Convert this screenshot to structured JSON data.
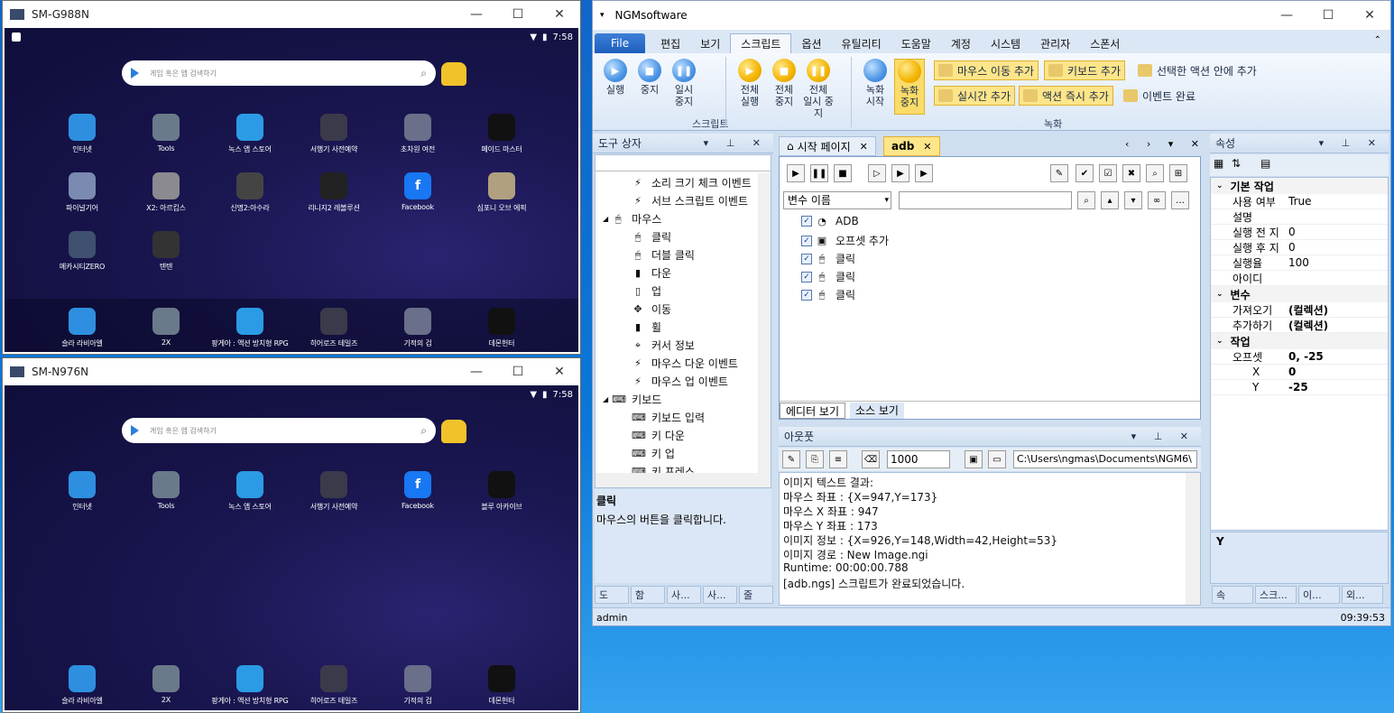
{
  "emulator_top": {
    "title": "SM-G988N",
    "time": "7:58",
    "search_placeholder": "게임 혹은 앱 검색하기",
    "apps_row1": [
      "인터넷",
      "Tools",
      "녹스 앱 스토어",
      "서행기 사전예약",
      "초차원 여전",
      "페이드 마스터"
    ],
    "apps_row2": [
      "파이널기어",
      "X2: 아르킵스",
      "신명2:아수라",
      "리니지2 레볼루션",
      "Facebook",
      "심포니 오브 에픽"
    ],
    "apps_row3": [
      "메카시티ZERO",
      "텐텐"
    ],
    "dock": [
      "슬라 라비아엘",
      "2X",
      "팡게아 : 액션 방치형 RPG",
      "히어로즈 테일즈",
      "기적의 검",
      "데몬헌터"
    ]
  },
  "emulator_bottom": {
    "title": "SM-N976N",
    "time": "7:58",
    "search_placeholder": "게임 혹은 앱 검색하기",
    "apps_row1": [
      "인터넷",
      "Tools",
      "녹스 앱 스토어",
      "서행기 사전예약",
      "Facebook",
      "블루 아카이브"
    ],
    "dock": [
      "슬라 라비아엘",
      "2X",
      "팡게아 : 액션 방치형 RPG",
      "히어로즈 테일즈",
      "기적의 검",
      "데몬헌터"
    ]
  },
  "ngm": {
    "title": "NGMsoftware",
    "tabs": [
      "File",
      "편집",
      "보기",
      "스크립트",
      "옵션",
      "유틸리티",
      "도움말",
      "계정",
      "시스템",
      "관리자",
      "스폰서"
    ],
    "active_tab": "스크립트",
    "ribbon": {
      "script_buttons": [
        "실행",
        "중지",
        "일시 중지",
        "전체\n실행",
        "전체\n중지",
        "전체\n일시 중지"
      ],
      "script_group": "스크립트",
      "record_buttons": [
        "녹화\n시작",
        "녹화\n중지"
      ],
      "record_small": [
        "마우스 이동 추가",
        "키보드 추가",
        "선택한 액션 안에 추가",
        "실시간 추가",
        "액션 즉시 추가",
        "이벤트 완료"
      ],
      "record_group": "녹화"
    },
    "toolbox": {
      "title": "도구 상자",
      "items": [
        {
          "label": "소리 크기 체크 이벤트",
          "icon": "⚡",
          "indent": 2
        },
        {
          "label": "서브 스크립트 이벤트",
          "icon": "⚡",
          "indent": 2
        },
        {
          "label": "마우스",
          "icon": "🖱",
          "indent": 1
        },
        {
          "label": "클릭",
          "icon": "🖱",
          "indent": 2
        },
        {
          "label": "더블 클릭",
          "icon": "🖱",
          "indent": 2
        },
        {
          "label": "다운",
          "icon": "▮",
          "indent": 2
        },
        {
          "label": "업",
          "icon": "▯",
          "indent": 2
        },
        {
          "label": "이동",
          "icon": "✥",
          "indent": 2
        },
        {
          "label": "휠",
          "icon": "▮",
          "indent": 2
        },
        {
          "label": "커서 정보",
          "icon": "⌖",
          "indent": 2
        },
        {
          "label": "마우스 다운 이벤트",
          "icon": "⚡",
          "indent": 2
        },
        {
          "label": "마우스 업 이벤트",
          "icon": "⚡",
          "indent": 2
        },
        {
          "label": "키보드",
          "icon": "⌨",
          "indent": 1
        },
        {
          "label": "키보드 입력",
          "icon": "⌨",
          "indent": 2
        },
        {
          "label": "키 다운",
          "icon": "⌨",
          "indent": 2
        },
        {
          "label": "키 업",
          "icon": "⌨",
          "indent": 2
        },
        {
          "label": "키 프레스",
          "icon": "⌨",
          "indent": 2
        }
      ],
      "desc_title": "클릭",
      "desc_text": "마우스의 버튼을 클릭합니다.",
      "bottom_tabs": [
        "도",
        "함",
        "사...",
        "사...",
        "줄"
      ]
    },
    "doc_tabs": [
      "시작 페이지",
      "adb"
    ],
    "editor": {
      "var_select": "변수 이름",
      "nodes": [
        "ADB",
        "오프셋 추가",
        "클릭",
        "클릭",
        "클릭"
      ],
      "view_tabs": [
        "에디터 보기",
        "소스 보기"
      ]
    },
    "output": {
      "title": "아웃풋",
      "count": "1000",
      "path": "C:\\Users\\ngmas\\Documents\\NGM6\\",
      "lines": [
        "이미지 텍스트 결과:",
        "마우스 좌표 : {X=947,Y=173}",
        "마우스 X 좌표 : 947",
        "마우스 Y 좌표 : 173",
        "이미지 정보 : {X=926,Y=148,Width=42,Height=53}",
        "이미지 경로 : New Image.ngi",
        "Runtime: 00:00:00.788",
        "[adb.ngs] 스크립트가 완료되었습니다."
      ]
    },
    "properties": {
      "title": "속성",
      "cat1": "기본 작업",
      "rows1": [
        [
          "사용 여부",
          "True"
        ],
        [
          "설명",
          ""
        ],
        [
          "실행 전 지",
          "0"
        ],
        [
          "실행 후 지",
          "0"
        ],
        [
          "실행율",
          "100"
        ],
        [
          "아이디",
          ""
        ]
      ],
      "cat2": "변수",
      "rows2": [
        [
          "가져오기",
          "(컬렉션)"
        ],
        [
          "추가하기",
          "(컬렉션)"
        ]
      ],
      "cat3": "작업",
      "rows3": [
        [
          "오프셋",
          "0, -25"
        ],
        [
          "X",
          "0"
        ],
        [
          "Y",
          "-25"
        ]
      ],
      "desc": "Y",
      "bottom_tabs": [
        "속",
        "스크...",
        "이...",
        "외..."
      ]
    },
    "status": {
      "user": "admin",
      "time": "09:39:53"
    }
  }
}
